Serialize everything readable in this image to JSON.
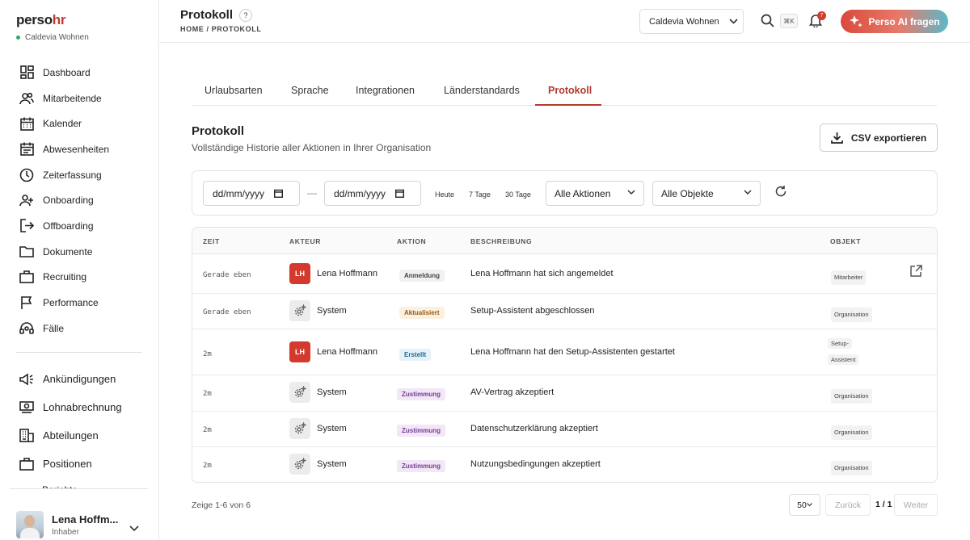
{
  "brand": {
    "logo_a": "perso",
    "logo_b": "hr",
    "org": "Caldevia Wohnen",
    "accent": "#b03a2e"
  },
  "sidebar": {
    "items": [
      {
        "label": "Dashboard",
        "icon": "dashboard-icon"
      },
      {
        "label": "Mitarbeitende",
        "icon": "users-icon"
      },
      {
        "label": "Kalender",
        "icon": "calendar-icon"
      },
      {
        "label": "Abwesenheiten",
        "icon": "absence-icon"
      },
      {
        "label": "Zeiterfassung",
        "icon": "clock-icon"
      },
      {
        "label": "Onboarding",
        "icon": "user-plus-icon"
      },
      {
        "label": "Offboarding",
        "icon": "logout-icon"
      },
      {
        "label": "Dokumente",
        "icon": "folder-icon"
      },
      {
        "label": "Recruiting",
        "icon": "briefcase-icon"
      },
      {
        "label": "Performance",
        "icon": "flag-icon"
      },
      {
        "label": "Fälle",
        "icon": "headset-icon"
      }
    ],
    "items2": [
      {
        "label": "Ankündigungen",
        "icon": "megaphone-icon"
      },
      {
        "label": "Lohnabrechnung",
        "icon": "money-icon"
      },
      {
        "label": "Abteilungen",
        "icon": "building-icon"
      },
      {
        "label": "Positionen",
        "icon": "briefcase-icon"
      }
    ],
    "cut_item": "Berichte",
    "user": {
      "name": "Lena Hoffm...",
      "role": "Inhaber"
    }
  },
  "header": {
    "title": "Protokoll",
    "help": "?",
    "breadcrumb": "HOME / PROTOKOLL",
    "org_select": "Caldevia Wohnen",
    "kbd": "⌘K",
    "notifications": "7",
    "ai_button": "Perso AI fragen"
  },
  "tabs": [
    "Urlaubsarten",
    "Sprache",
    "Integrationen",
    "Länderstandards",
    "Protokoll"
  ],
  "section": {
    "title": "Protokoll",
    "subtitle": "Vollständige Historie aller Aktionen in Ihrer Organisation",
    "csv_button": "CSV exportieren"
  },
  "filters": {
    "date_from": "dd/mm/yyyy",
    "date_to": "dd/mm/yyyy",
    "dash": "—",
    "quick": [
      "Heute",
      "7 Tage",
      "30 Tage"
    ],
    "actions": "Alle Aktionen",
    "objects": "Alle Objekte"
  },
  "table": {
    "headers": [
      "ZEIT",
      "AKTEUR",
      "AKTION",
      "BESCHREIBUNG",
      "OBJEKT"
    ],
    "rows": [
      {
        "time": "Gerade eben",
        "actor": "Lena Hoffmann",
        "initials": "LH",
        "action": "Anmeldung",
        "desc": "Lena Hoffmann hat sich angemeldet",
        "object": "Mitarbeiter"
      },
      {
        "time": "Gerade eben",
        "actor": "System",
        "initials": "",
        "action": "Aktualisiert",
        "desc": "Setup-Assistent abgeschlossen",
        "object": "Organisation"
      },
      {
        "time": "2m",
        "actor": "Lena Hoffmann",
        "initials": "LH",
        "action": "Erstellt",
        "desc": "Lena Hoffmann hat den Setup-Assistenten gestartet",
        "object_a": "Setup-",
        "object_b": "Assistent"
      },
      {
        "time": "2m",
        "actor": "System",
        "initials": "",
        "action": "Zustimmung",
        "desc": "AV-Vertrag akzeptiert",
        "object": "Organisation"
      },
      {
        "time": "2m",
        "actor": "System",
        "initials": "",
        "action": "Zustimmung",
        "desc": "Datenschutzerklärung akzeptiert",
        "object": "Organisation"
      },
      {
        "time": "2m",
        "actor": "System",
        "initials": "",
        "action": "Zustimmung",
        "desc": "Nutzungsbedingungen akzeptiert",
        "object": "Organisation"
      }
    ]
  },
  "pagination": {
    "summary": "Zeige 1-6 von 6",
    "size": "50",
    "prev": "Zurück",
    "info": "1 / 1",
    "next": "Weiter"
  }
}
